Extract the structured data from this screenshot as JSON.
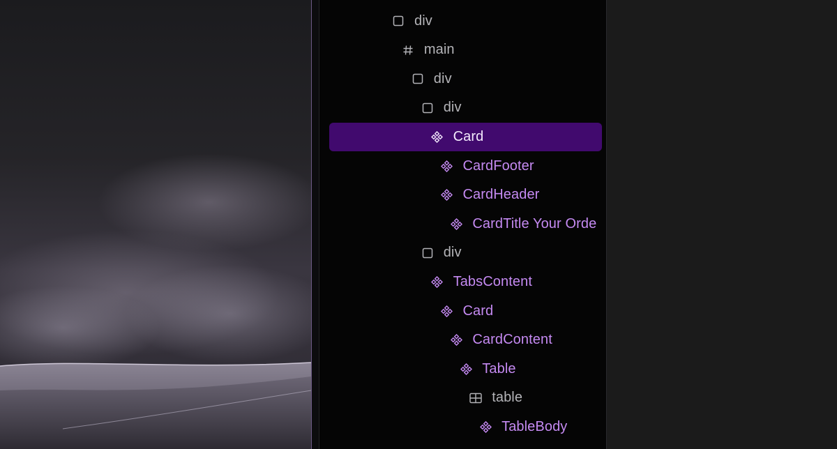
{
  "layers_panel": {
    "rows": [
      {
        "label": "div",
        "kind": "element",
        "icon": "frame-icon",
        "depth": 0
      },
      {
        "label": "main",
        "kind": "element",
        "icon": "hash-icon",
        "depth": 1
      },
      {
        "label": "div",
        "kind": "element",
        "icon": "frame-icon",
        "depth": 2
      },
      {
        "label": "div",
        "kind": "element",
        "icon": "frame-icon",
        "depth": 3
      },
      {
        "label": "Card",
        "kind": "component",
        "icon": "component-icon",
        "depth": 4,
        "selected": true
      },
      {
        "label": "CardFooter",
        "kind": "component",
        "icon": "component-icon",
        "depth": 5
      },
      {
        "label": "CardHeader",
        "kind": "component",
        "icon": "component-icon",
        "depth": 5
      },
      {
        "label": "CardTitle Your Orde",
        "kind": "component",
        "icon": "component-icon",
        "depth": 6
      },
      {
        "label": "div",
        "kind": "element",
        "icon": "frame-icon",
        "depth": 3
      },
      {
        "label": "TabsContent",
        "kind": "component",
        "icon": "component-icon",
        "depth": 4
      },
      {
        "label": "Card",
        "kind": "component",
        "icon": "component-icon",
        "depth": 5
      },
      {
        "label": "CardContent",
        "kind": "component",
        "icon": "component-icon",
        "depth": 6
      },
      {
        "label": "Table",
        "kind": "component",
        "icon": "component-icon",
        "depth": 7
      },
      {
        "label": "table",
        "kind": "element",
        "icon": "table-icon",
        "depth": 8
      },
      {
        "label": "TableBody",
        "kind": "component",
        "icon": "component-icon",
        "depth": 9
      }
    ]
  },
  "colors": {
    "selected_row": "#410a6e",
    "component_text": "#c58af2",
    "element_text": "#b4b4b8"
  }
}
